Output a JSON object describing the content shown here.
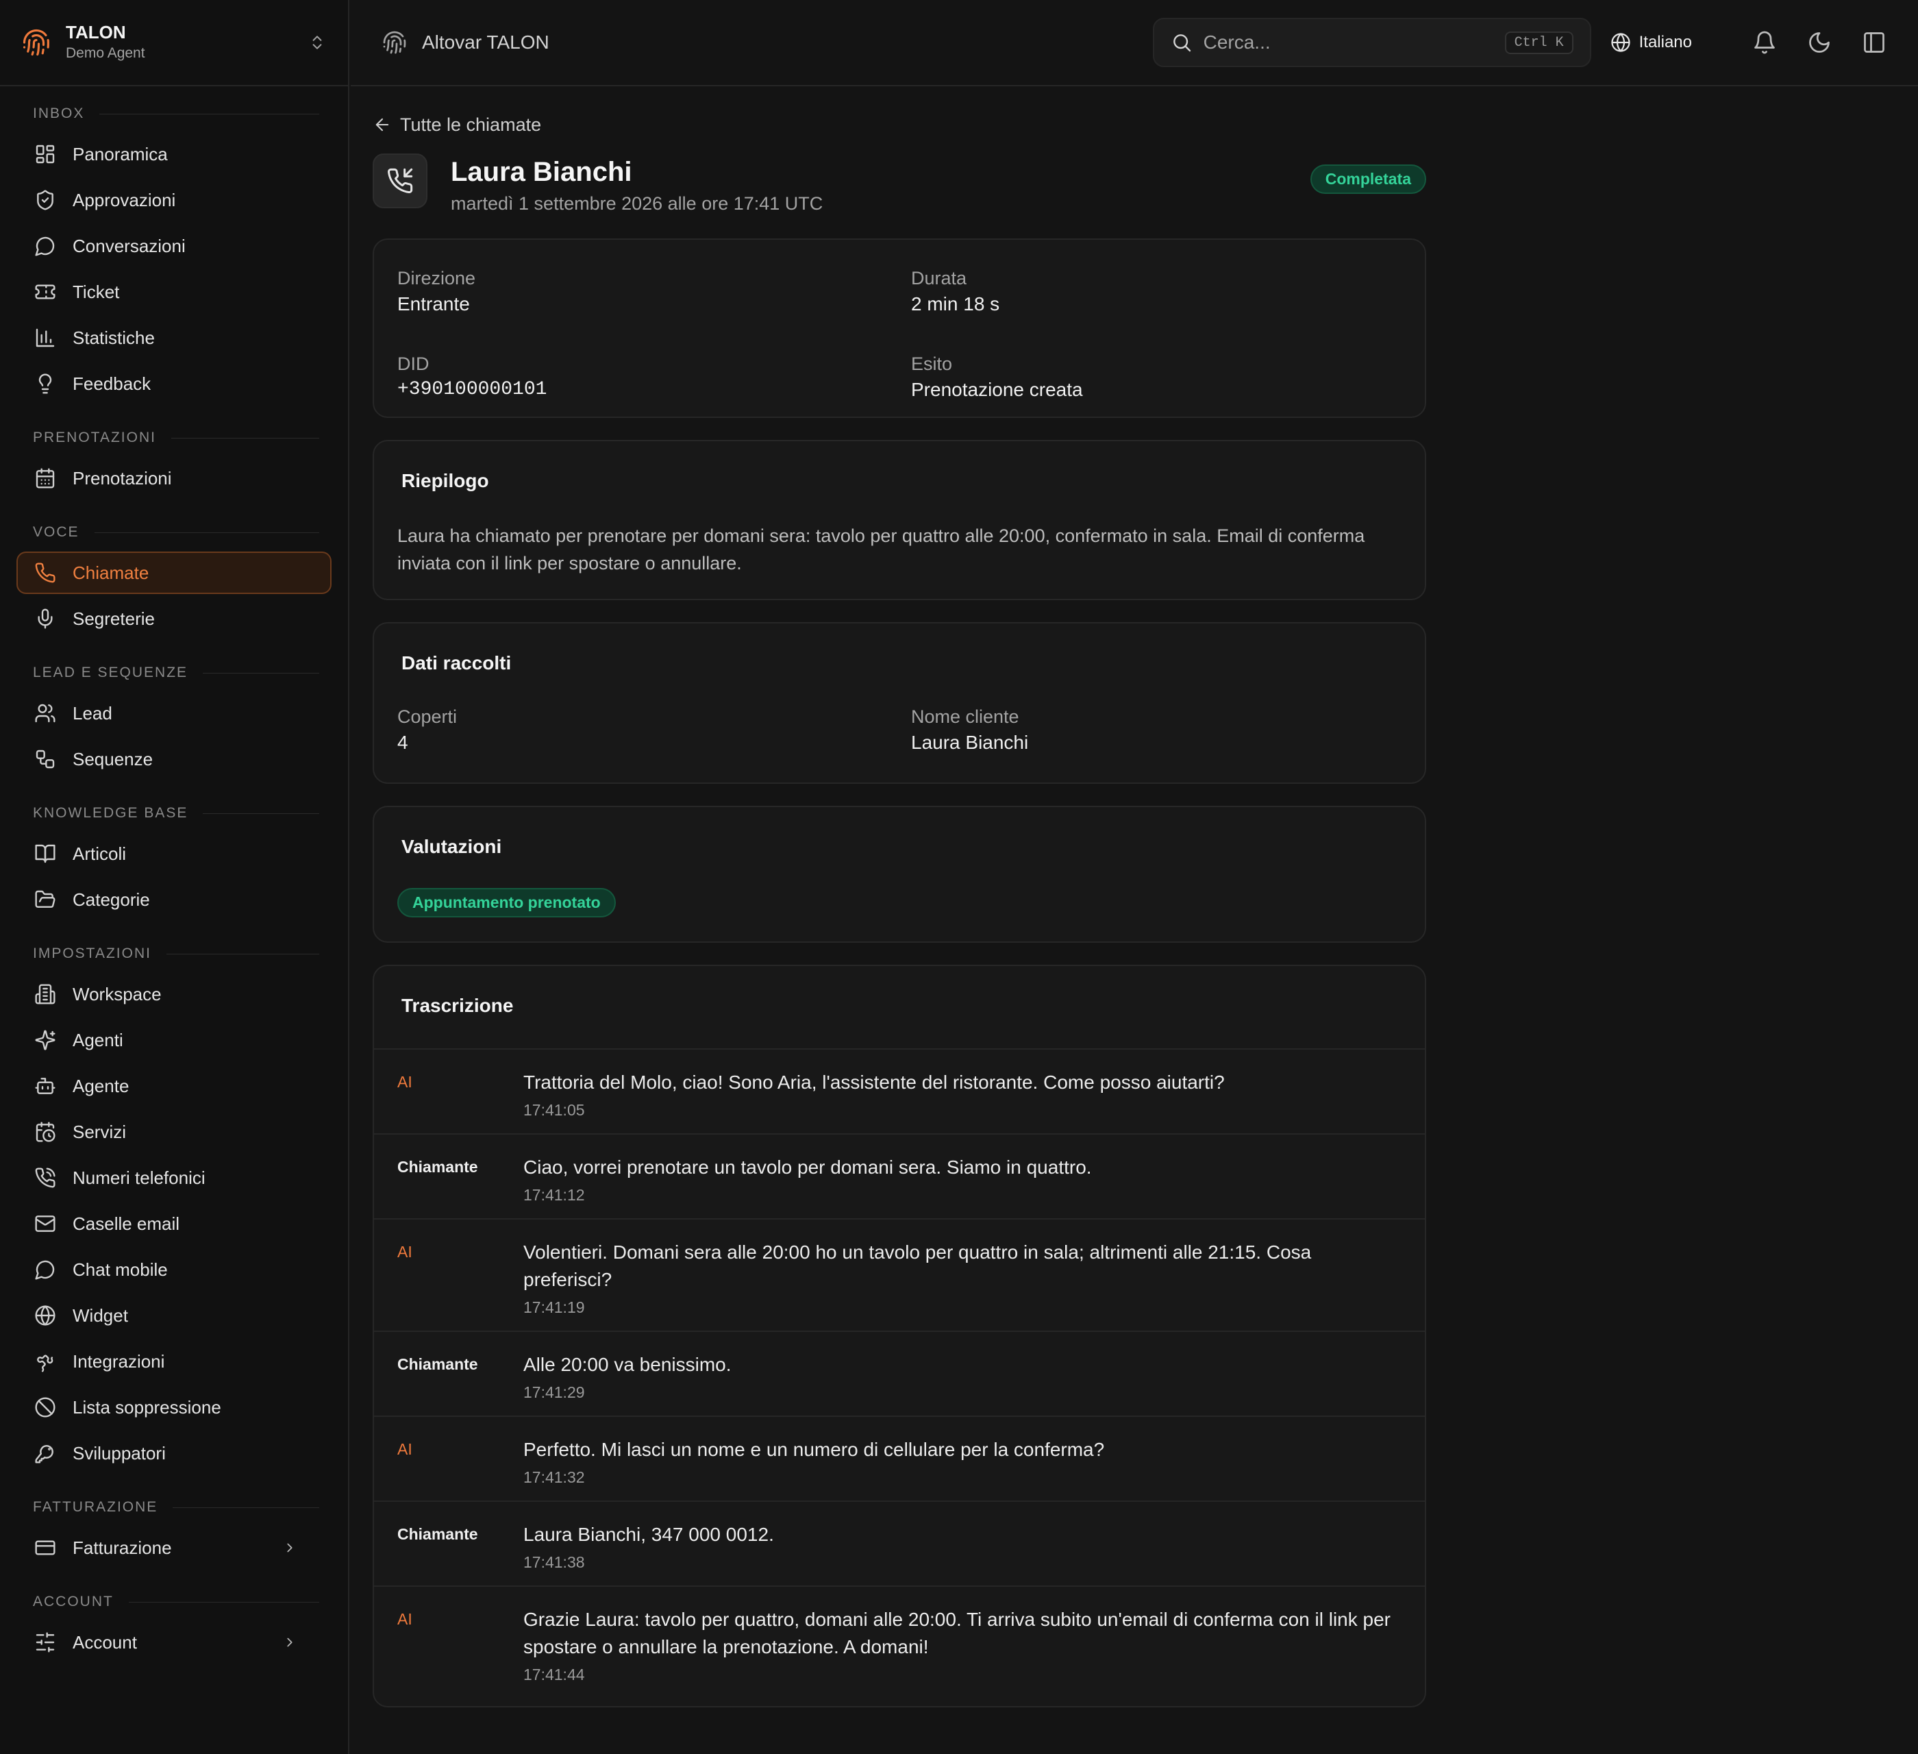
{
  "brand": {
    "name": "TALON",
    "subtitle": "Demo Agent"
  },
  "topbar": {
    "app_name": "Altovar TALON",
    "search_placeholder": "Cerca...",
    "search_shortcut": "Ctrl K",
    "language": "Italiano"
  },
  "sidebar": {
    "sections": [
      {
        "label": "INBOX",
        "items": [
          {
            "label": "Panoramica",
            "icon": "grid-icon"
          },
          {
            "label": "Approvazioni",
            "icon": "shield-icon"
          },
          {
            "label": "Conversazioni",
            "icon": "chat-bubble-icon"
          },
          {
            "label": "Ticket",
            "icon": "ticket-icon"
          },
          {
            "label": "Statistiche",
            "icon": "bar-chart-icon"
          },
          {
            "label": "Feedback",
            "icon": "lightbulb-icon"
          }
        ]
      },
      {
        "label": "PRENOTAZIONI",
        "items": [
          {
            "label": "Prenotazioni",
            "icon": "calendar-icon"
          }
        ]
      },
      {
        "label": "VOCE",
        "items": [
          {
            "label": "Chiamate",
            "icon": "phone-icon",
            "active": true
          },
          {
            "label": "Segreterie",
            "icon": "microphone-icon"
          }
        ]
      },
      {
        "label": "LEAD E SEQUENZE",
        "items": [
          {
            "label": "Lead",
            "icon": "users-icon"
          },
          {
            "label": "Sequenze",
            "icon": "workflow-icon"
          }
        ]
      },
      {
        "label": "KNOWLEDGE BASE",
        "items": [
          {
            "label": "Articoli",
            "icon": "book-icon"
          },
          {
            "label": "Categorie",
            "icon": "folder-icon"
          }
        ]
      },
      {
        "label": "IMPOSTAZIONI",
        "items": [
          {
            "label": "Workspace",
            "icon": "building-icon"
          },
          {
            "label": "Agenti",
            "icon": "sparkles-icon"
          },
          {
            "label": "Agente",
            "icon": "robot-icon"
          },
          {
            "label": "Servizi",
            "icon": "calendar-clock-icon"
          },
          {
            "label": "Numeri telefonici",
            "icon": "phone-call-icon"
          },
          {
            "label": "Caselle email",
            "icon": "mail-icon"
          },
          {
            "label": "Chat mobile",
            "icon": "chat-bubble-icon"
          },
          {
            "label": "Widget",
            "icon": "globe-icon"
          },
          {
            "label": "Integrazioni",
            "icon": "puzzle-icon"
          },
          {
            "label": "Lista soppressione",
            "icon": "ban-icon"
          },
          {
            "label": "Sviluppatori",
            "icon": "key-icon"
          }
        ]
      },
      {
        "label": "FATTURAZIONE",
        "items": [
          {
            "label": "Fatturazione",
            "icon": "credit-card-icon",
            "chevron": true
          }
        ]
      },
      {
        "label": "ACCOUNT",
        "items": [
          {
            "label": "Account",
            "icon": "sliders-icon",
            "chevron": true
          }
        ]
      }
    ]
  },
  "main": {
    "back_label": "Tutte le chiamate",
    "title": "Laura Bianchi",
    "subtitle": "martedì 1 settembre 2026 alle ore 17:41 UTC",
    "status": "Completata",
    "meta": {
      "direction_label": "Direzione",
      "direction_value": "Entrante",
      "duration_label": "Durata",
      "duration_value": "2 min 18 s",
      "did_label": "DID",
      "did_value": "+390100000101",
      "outcome_label": "Esito",
      "outcome_value": "Prenotazione creata"
    },
    "summary": {
      "title": "Riepilogo",
      "text": "Laura ha chiamato per prenotare per domani sera: tavolo per quattro alle 20:00, confermato in sala. Email di conferma inviata con il link per spostare o annullare."
    },
    "collected": {
      "title": "Dati raccolti",
      "covers_label": "Coperti",
      "covers_value": "4",
      "name_label": "Nome cliente",
      "name_value": "Laura Bianchi"
    },
    "ratings": {
      "title": "Valutazioni",
      "badge": "Appuntamento prenotato"
    },
    "transcript": {
      "title": "Trascrizione",
      "turns": [
        {
          "speaker": "AI",
          "type": "ai",
          "text": "Trattoria del Molo, ciao! Sono Aria, l'assistente del ristorante. Come posso aiutarti?",
          "time": "17:41:05"
        },
        {
          "speaker": "Chiamante",
          "type": "human",
          "text": "Ciao, vorrei prenotare un tavolo per domani sera. Siamo in quattro.",
          "time": "17:41:12"
        },
        {
          "speaker": "AI",
          "type": "ai",
          "text": "Volentieri. Domani sera alle 20:00 ho un tavolo per quattro in sala; altrimenti alle 21:15. Cosa preferisci?",
          "time": "17:41:19"
        },
        {
          "speaker": "Chiamante",
          "type": "human",
          "text": "Alle 20:00 va benissimo.",
          "time": "17:41:29"
        },
        {
          "speaker": "AI",
          "type": "ai",
          "text": "Perfetto. Mi lasci un nome e un numero di cellulare per la conferma?",
          "time": "17:41:32"
        },
        {
          "speaker": "Chiamante",
          "type": "human",
          "text": "Laura Bianchi, 347 000 0012.",
          "time": "17:41:38"
        },
        {
          "speaker": "AI",
          "type": "ai",
          "text": "Grazie Laura: tavolo per quattro, domani alle 20:00. Ti arriva subito un'email di conferma con il link per spostare o annullare la prenotazione. A domani!",
          "time": "17:41:44"
        }
      ]
    }
  },
  "colors": {
    "accent": "#f07a3c",
    "success": "#34d399",
    "background": "#141414",
    "sidebar": "#111111",
    "card": "#181818"
  }
}
